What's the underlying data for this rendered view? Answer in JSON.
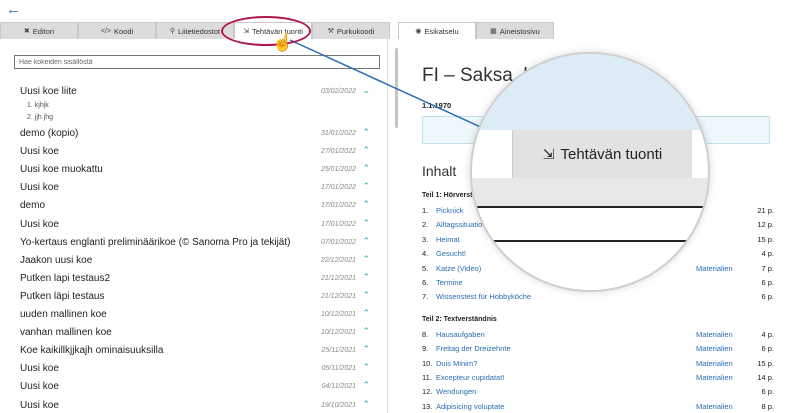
{
  "left_tabs": [
    {
      "label": "Editori",
      "icon": "tools-icon",
      "glyph": "✖",
      "active": false
    },
    {
      "label": "Koodi",
      "icon": "code-icon",
      "glyph": "</>",
      "active": false
    },
    {
      "label": "Liitetiedostot",
      "icon": "paperclip-icon",
      "glyph": "⚲",
      "active": false
    },
    {
      "label": "Tehtävän tuonti",
      "icon": "file-import-icon",
      "glyph": "⇲",
      "active": true
    },
    {
      "label": "Purkukoodi",
      "icon": "hammer-icon",
      "glyph": "⚒",
      "active": false
    }
  ],
  "right_tabs": [
    {
      "label": "Esikatselu",
      "icon": "eye-icon",
      "glyph": "◉",
      "active": true
    },
    {
      "label": "Aineistosivu",
      "icon": "book-icon",
      "glyph": "▦",
      "active": false
    }
  ],
  "search": {
    "placeholder": "Hae kokeiden sisällöstä"
  },
  "list": {
    "first": {
      "title": "Uusi koe liite",
      "date": "03/02/2022"
    },
    "subitems": [
      "1. kjhjk",
      "2. jjh jhg"
    ],
    "rows": [
      {
        "title": "demo (kopio)",
        "date": "31/01/2022"
      },
      {
        "title": "Uusi koe",
        "date": "27/01/2022"
      },
      {
        "title": "Uusi koe muokattu",
        "date": "25/01/2022"
      },
      {
        "title": "Uusi koe",
        "date": "17/01/2022"
      },
      {
        "title": "demo",
        "date": "17/01/2022"
      },
      {
        "title": "Uusi koe",
        "date": "17/01/2022"
      },
      {
        "title": "Yo-kertaus englanti preliminäärikoe (© Sanoma Pro ja tekijät)",
        "date": "07/01/2022"
      },
      {
        "title": "Jaakon uusi koe",
        "date": "22/12/2021"
      },
      {
        "title": "Putken lapi testaus2",
        "date": "21/12/2021"
      },
      {
        "title": "Putken läpi testaus",
        "date": "21/12/2021"
      },
      {
        "title": "uuden mallinen koe",
        "date": "10/12/2021"
      },
      {
        "title": "vanhan mallinen koe",
        "date": "10/12/2021"
      },
      {
        "title": "Koe kaikillkjjkajh ominaisuuksilla",
        "date": "25/11/2021"
      },
      {
        "title": "Uusi koe",
        "date": "05/11/2021"
      },
      {
        "title": "Uusi koe",
        "date": "04/11/2021"
      },
      {
        "title": "Uusi koe",
        "date": "19/10/2021"
      }
    ]
  },
  "preview": {
    "title": "FI – Saksa, lyh",
    "date": "1.1.1970",
    "contents_title": "Inhalt",
    "sections": [
      {
        "title": "Teil 1: Hörverst",
        "items": [
          {
            "num": "1.",
            "name": "Picknick",
            "materials": "",
            "points": "21 p."
          },
          {
            "num": "2.",
            "name": "Alltagssituatio",
            "materials": "",
            "points": "12 p."
          },
          {
            "num": "3.",
            "name": "Heimat",
            "materials": "",
            "points": "15 p."
          },
          {
            "num": "4.",
            "name": "Gesucht!",
            "materials": "",
            "points": "4 p."
          },
          {
            "num": "5.",
            "name": "Katze (Video)",
            "materials": "Materialien",
            "points": "7 p."
          },
          {
            "num": "6.",
            "name": "Termine",
            "materials": "",
            "points": "6 p."
          },
          {
            "num": "7.",
            "name": "Wissenstest für Hobbyköche",
            "materials": "",
            "points": "6 p."
          }
        ]
      },
      {
        "title": "Teil 2: Textverständnis",
        "items": [
          {
            "num": "8.",
            "name": "Hausaufgaben",
            "materials": "Materialien",
            "points": "4 p."
          },
          {
            "num": "9.",
            "name": "Freitag der Dreizehnte",
            "materials": "Materialien",
            "points": "6 p."
          },
          {
            "num": "10.",
            "name": "Duis Minim?",
            "materials": "Materialien",
            "points": "15 p."
          },
          {
            "num": "11.",
            "name": "Excepteur cupidatat!",
            "materials": "Materialien",
            "points": "14 p."
          },
          {
            "num": "12.",
            "name": "Wendungen",
            "materials": "",
            "points": "6 p."
          },
          {
            "num": "13.",
            "name": "Adipisicing voluptate",
            "materials": "Materialien",
            "points": "8 p."
          }
        ]
      }
    ]
  },
  "magnifier": {
    "label": "Tehtävän tuonti",
    "icon": "file-import-icon"
  },
  "colors": {
    "accent": "#2a6db5",
    "chevron": "#2a9db5",
    "highlight": "#b1154a",
    "info_box": "#eef7fb"
  }
}
